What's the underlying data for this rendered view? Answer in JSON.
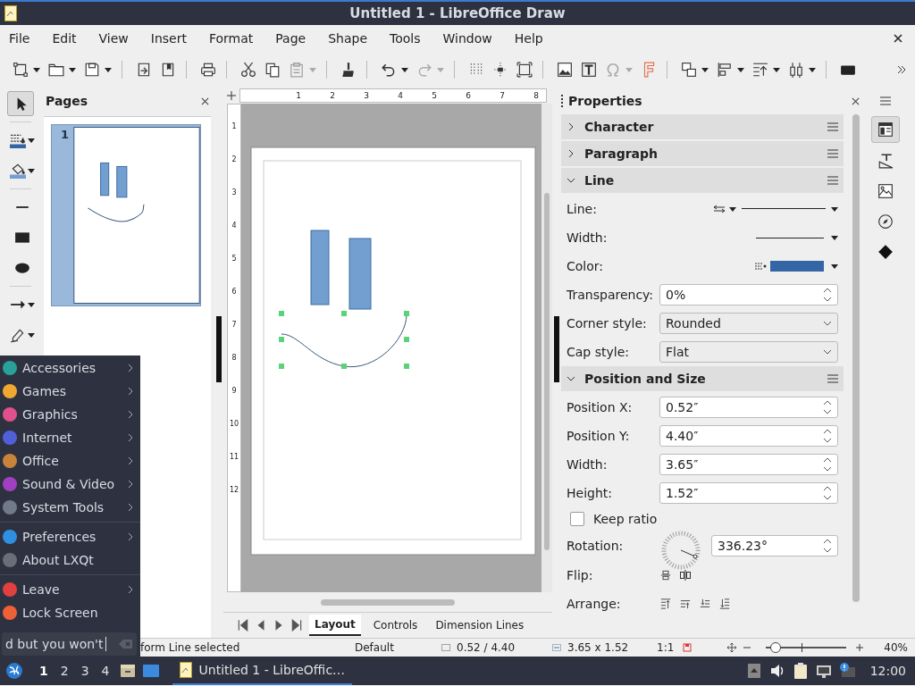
{
  "window": {
    "title": "Untitled 1 - LibreOffice Draw"
  },
  "menu": [
    "File",
    "Edit",
    "View",
    "Insert",
    "Format",
    "Page",
    "Shape",
    "Tools",
    "Window",
    "Help"
  ],
  "pages_panel": {
    "title": "Pages",
    "pages": [
      {
        "number": "1",
        "selected": true
      }
    ]
  },
  "rulers": {
    "horizontal": [
      "1",
      "2",
      "3",
      "4",
      "5",
      "6",
      "7",
      "8"
    ],
    "vertical": [
      "1",
      "2",
      "3",
      "4",
      "5",
      "6",
      "7",
      "8",
      "9",
      "10",
      "11",
      "12"
    ]
  },
  "canvas_tabs": [
    {
      "label": "Layout",
      "selected": true
    },
    {
      "label": "Controls",
      "selected": false
    },
    {
      "label": "Dimension Lines",
      "selected": false
    }
  ],
  "properties": {
    "title": "Properties",
    "sections": [
      {
        "title": "Character",
        "expanded": false
      },
      {
        "title": "Paragraph",
        "expanded": false
      },
      {
        "title": "Line",
        "expanded": true,
        "rows": [
          {
            "kind": "line-style",
            "label": "Line:"
          },
          {
            "kind": "line-width",
            "label": "Width:"
          },
          {
            "kind": "line-color",
            "label": "Color:"
          },
          {
            "kind": "spin",
            "label": "Transparency:",
            "value": "0%"
          },
          {
            "kind": "select",
            "label": "Corner style:",
            "value": "Rounded"
          },
          {
            "kind": "select",
            "label": "Cap style:",
            "value": "Flat"
          }
        ]
      },
      {
        "title": "Position and Size",
        "expanded": true,
        "rows": [
          {
            "kind": "spin",
            "label": "Position X:",
            "value": "0.52″"
          },
          {
            "kind": "spin",
            "label": "Position Y:",
            "value": "4.40″"
          },
          {
            "kind": "spin",
            "label": "Width:",
            "value": "3.65″"
          },
          {
            "kind": "spin",
            "label": "Height:",
            "value": "1.52″"
          },
          {
            "kind": "checkbox",
            "label": "Keep ratio",
            "checked": false
          },
          {
            "kind": "rotation",
            "label": "Rotation:",
            "value": "336.23°"
          },
          {
            "kind": "flip",
            "label": "Flip:"
          },
          {
            "kind": "arrange",
            "label": "Arrange:"
          }
        ]
      }
    ]
  },
  "status_bar": {
    "selection": "form Line selected",
    "style": "Default",
    "position": "0.52 / 4.40",
    "size": "3.65 x 1.52",
    "scale": "1:1",
    "zoom": {
      "level": 0.1
    },
    "zoom_percent": "40%"
  },
  "start_menu": {
    "groups": [
      [
        {
          "label": "Accessories",
          "color": "#2aa198",
          "submenu": true
        },
        {
          "label": "Games",
          "color": "#f0a830",
          "submenu": true
        },
        {
          "label": "Graphics",
          "color": "#e0508a",
          "submenu": true
        },
        {
          "label": "Internet",
          "color": "#5060d8",
          "submenu": true
        },
        {
          "label": "Office",
          "color": "#c8843a",
          "submenu": true
        },
        {
          "label": "Sound & Video",
          "color": "#a040c0",
          "submenu": true
        },
        {
          "label": "System Tools",
          "color": "#707a88",
          "submenu": true
        }
      ],
      [
        {
          "label": "Preferences",
          "color": "#2f8fe0",
          "submenu": true
        },
        {
          "label": "About LXQt",
          "color": "#6a6e78",
          "submenu": false
        }
      ],
      [
        {
          "label": "Leave",
          "color": "#e04040",
          "submenu": true
        },
        {
          "label": "Lock Screen",
          "color": "#f06038",
          "submenu": false
        }
      ]
    ],
    "search": {
      "value": "d but you won't"
    }
  },
  "taskbar": {
    "workspaces": [
      {
        "label": "1",
        "selected": true
      },
      {
        "label": "2",
        "selected": false
      },
      {
        "label": "3",
        "selected": false
      },
      {
        "label": "4",
        "selected": false
      }
    ],
    "task": "Untitled 1 - LibreOffic…",
    "clock": "12:00"
  }
}
